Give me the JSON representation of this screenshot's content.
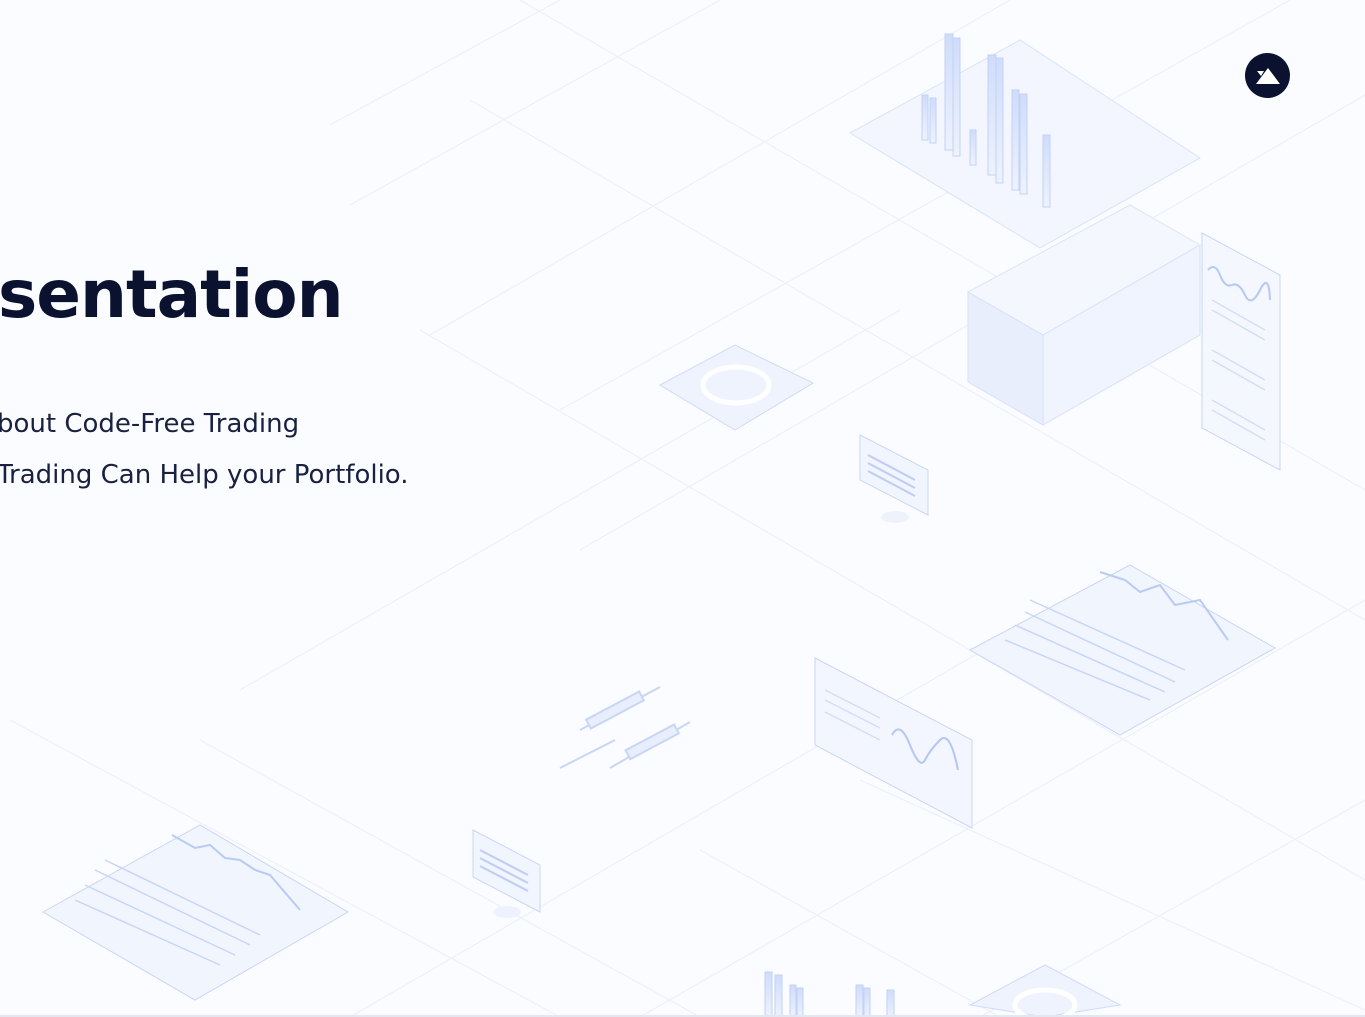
{
  "hero": {
    "title": "sentation",
    "line1": "bout Code-Free Trading",
    "line2": "Trading Can Help your Portfolio."
  },
  "logo": {
    "icon": "mountain-logo-icon"
  },
  "colors": {
    "background": "#fbfcff",
    "text_dark": "#0b1230",
    "accent_blue": "#c7d5f7"
  }
}
